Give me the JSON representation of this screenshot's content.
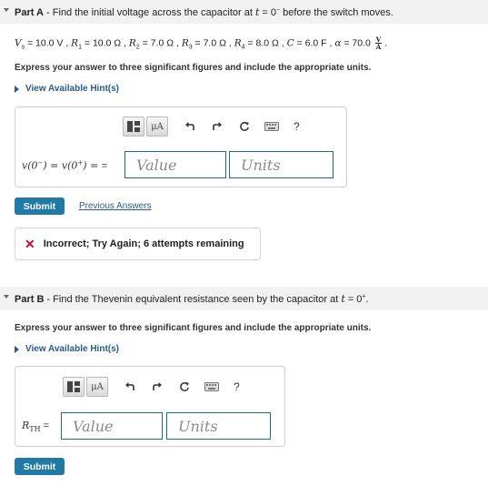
{
  "part_a": {
    "label": "Part A",
    "title": " - Find the initial voltage across the capacitor at ",
    "t_expr": "t",
    "eq": " = 0",
    "sup": "−",
    "tail": " before the switch moves.",
    "given": {
      "vs": "V",
      "vs_sub": "s",
      "vs_val": " = 10.0 V , ",
      "r1": "R",
      "r1_sub": "1",
      "r1_val": " = 10.0 Ω , ",
      "r2": "R",
      "r2_sub": "2",
      "r2_val": " = 7.0 Ω , ",
      "r3": "R",
      "r3_sub": "3",
      "r3_val": " = 7.0 Ω , ",
      "r4": "R",
      "r4_sub": "4",
      "r4_val": " = 8.0 Ω , ",
      "c": "C",
      "c_val": " = 6.0 F , ",
      "alpha": "α",
      "alpha_val": " = 70.0 ",
      "frac_num": "V",
      "frac_den": "A",
      "end": " ."
    },
    "instruction": "Express your answer to three significant figures and include the appropriate units.",
    "hint": "View Available Hint(s)",
    "toolbar": {
      "mu": "μA",
      "help": "?"
    },
    "label_expr": "v(0",
    "label_sup1": "−",
    "label_mid": ") = v(0",
    "label_sup2": "+",
    "label_end": ") = ",
    "label_eq": "=",
    "value_placeholder": "Value",
    "units_placeholder": "Units",
    "submit": "Submit",
    "previous_answers": "Previous Answers",
    "feedback": "Incorrect; Try Again; 6 attempts remaining"
  },
  "part_b": {
    "label": "Part B",
    "title": " - Find the Thevenin equivalent resistance seen by the capacitor at ",
    "t_expr": "t",
    "eq": " = 0",
    "sup": "+",
    "tail": ".",
    "instruction": "Express your answer to three significant figures and include the appropriate units.",
    "hint": "View Available Hint(s)",
    "toolbar": {
      "mu": "μA",
      "help": "?"
    },
    "label_r": "R",
    "label_sub": "TH",
    "label_eq": " =",
    "value_placeholder": "Value",
    "units_placeholder": "Units",
    "submit": "Submit"
  },
  "colors": {
    "submit_bg": "#207aa5",
    "link": "#2a5a88",
    "field_border": "#1e6d72",
    "error": "#c8102e",
    "header_bg": "#f2f2f2"
  },
  "icons": [
    "template-icon",
    "micro-units-icon",
    "undo-icon",
    "redo-icon",
    "reset-icon",
    "keyboard-icon",
    "help-icon",
    "incorrect-x-icon",
    "collapse-arrow-icon",
    "expand-triangle-icon"
  ]
}
